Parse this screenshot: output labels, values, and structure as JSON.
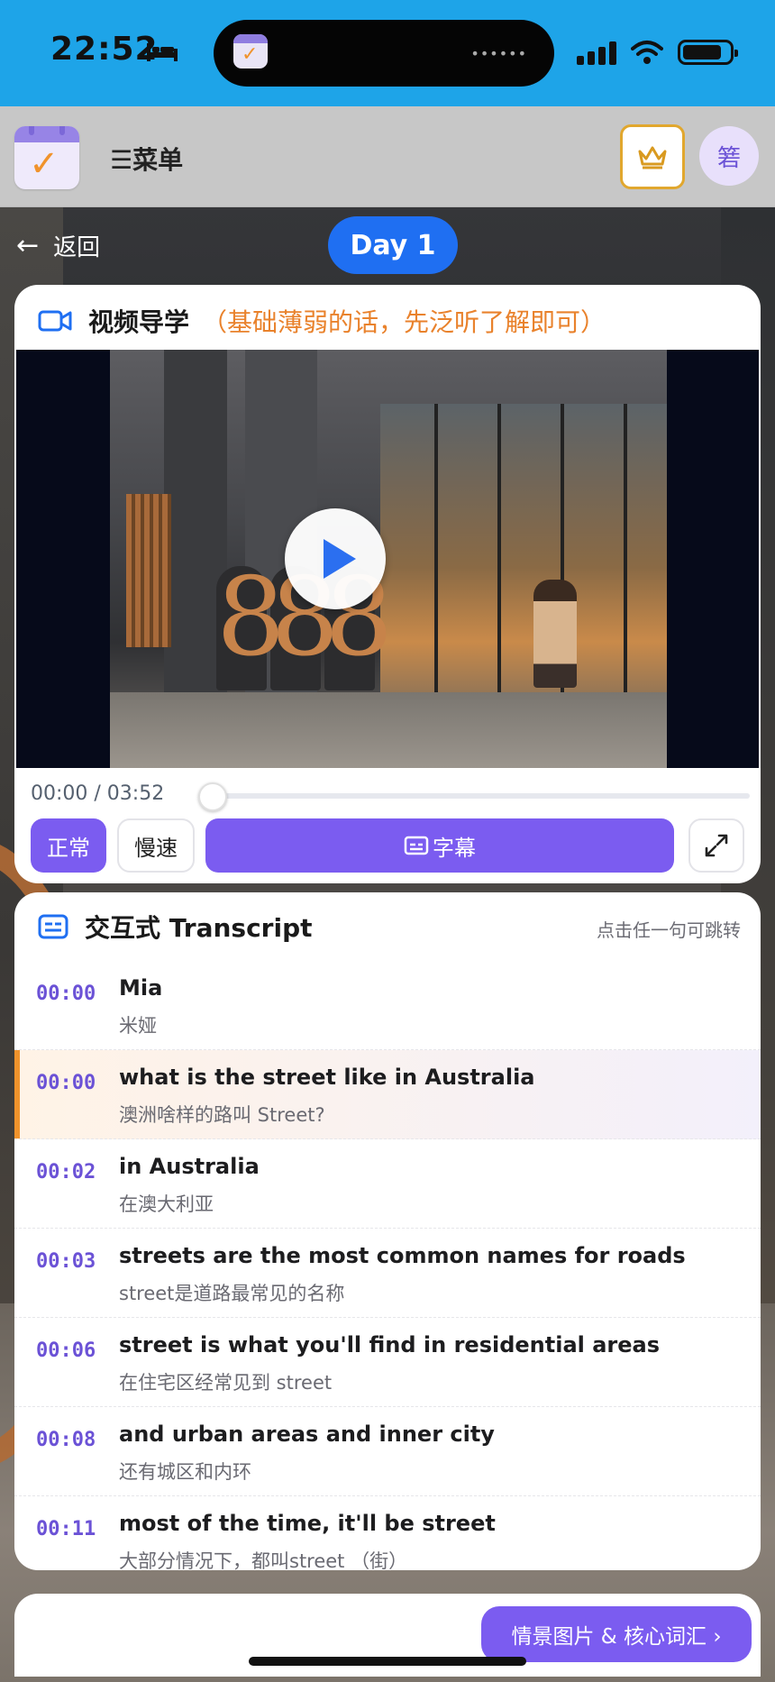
{
  "status_bar": {
    "time": "22:52",
    "island_dots": "••••••"
  },
  "header": {
    "menu_label": "☰菜单",
    "avatar_text": "箬"
  },
  "nav": {
    "back_label": "返回",
    "day_label": "Day 1"
  },
  "video": {
    "title": "视频导学",
    "hint": "（基础薄弱的话，先泛听了解即可）",
    "time": "00:00 / 03:52",
    "progress": 0,
    "buttons": {
      "normal": "正常",
      "slow": "慢速",
      "subtitles": "字幕",
      "fullscreen": "⤢"
    }
  },
  "transcript": {
    "title": "交互式 Transcript",
    "hint": "点击任一句可跳转",
    "rows": [
      {
        "ts": "00:00",
        "en": "Mia",
        "zh": "米娅",
        "active": false
      },
      {
        "ts": "00:00",
        "en": "what is the street like in Australia",
        "zh": "澳洲啥样的路叫 Street?",
        "active": true
      },
      {
        "ts": "00:02",
        "en": "in Australia",
        "zh": "在澳大利亚",
        "active": false
      },
      {
        "ts": "00:03",
        "en": "streets are the most common names for roads",
        "zh": "street是道路最常见的名称",
        "active": false
      },
      {
        "ts": "00:06",
        "en": "street is what you'll find in residential areas",
        "zh": "在住宅区经常见到 street",
        "active": false
      },
      {
        "ts": "00:08",
        "en": "and urban areas and inner city",
        "zh": "还有城区和内环",
        "active": false
      },
      {
        "ts": "00:11",
        "en": "most of the time, it'll be street",
        "zh": "大部分情况下，都叫street （街）",
        "active": false
      }
    ]
  },
  "footer": {
    "vocab_button": "情景图片 & 核心词汇 ›"
  },
  "colors": {
    "accent": "#7b5cf0",
    "status_bar": "#1ea4e8",
    "day_pill": "#1f6ff2",
    "active_marker": "#f0932c",
    "hint_orange": "#e9822c"
  }
}
